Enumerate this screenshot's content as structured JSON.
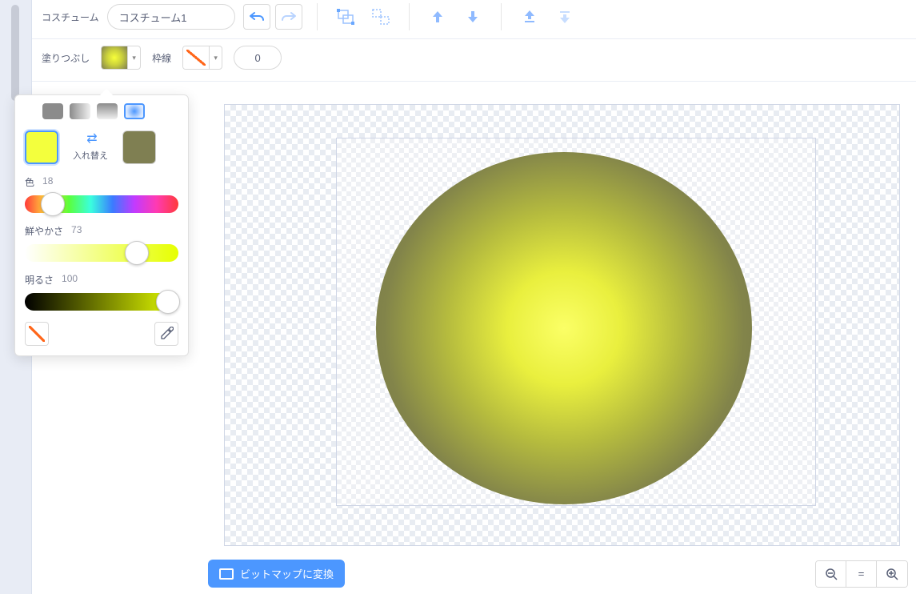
{
  "toolbar": {
    "costume_label": "コスチューム",
    "costume_name": "コスチューム1",
    "fill_label": "塗りつぶし",
    "outline_label": "枠線",
    "stroke_width": "0"
  },
  "color_picker": {
    "modes": [
      "solid",
      "horizontal",
      "vertical",
      "radial"
    ],
    "active_mode": "radial",
    "swap_label": "入れ替え",
    "color_a": "#f3ff3d",
    "color_b": "#7f7f52",
    "hue": {
      "label": "色",
      "value": 18
    },
    "saturation": {
      "label": "鮮やかさ",
      "value": 73
    },
    "brightness": {
      "label": "明るさ",
      "value": 100
    }
  },
  "footer": {
    "convert_label": "ビットマップに変換",
    "zoom_out": "−",
    "zoom_reset": "=",
    "zoom_in": "+"
  }
}
